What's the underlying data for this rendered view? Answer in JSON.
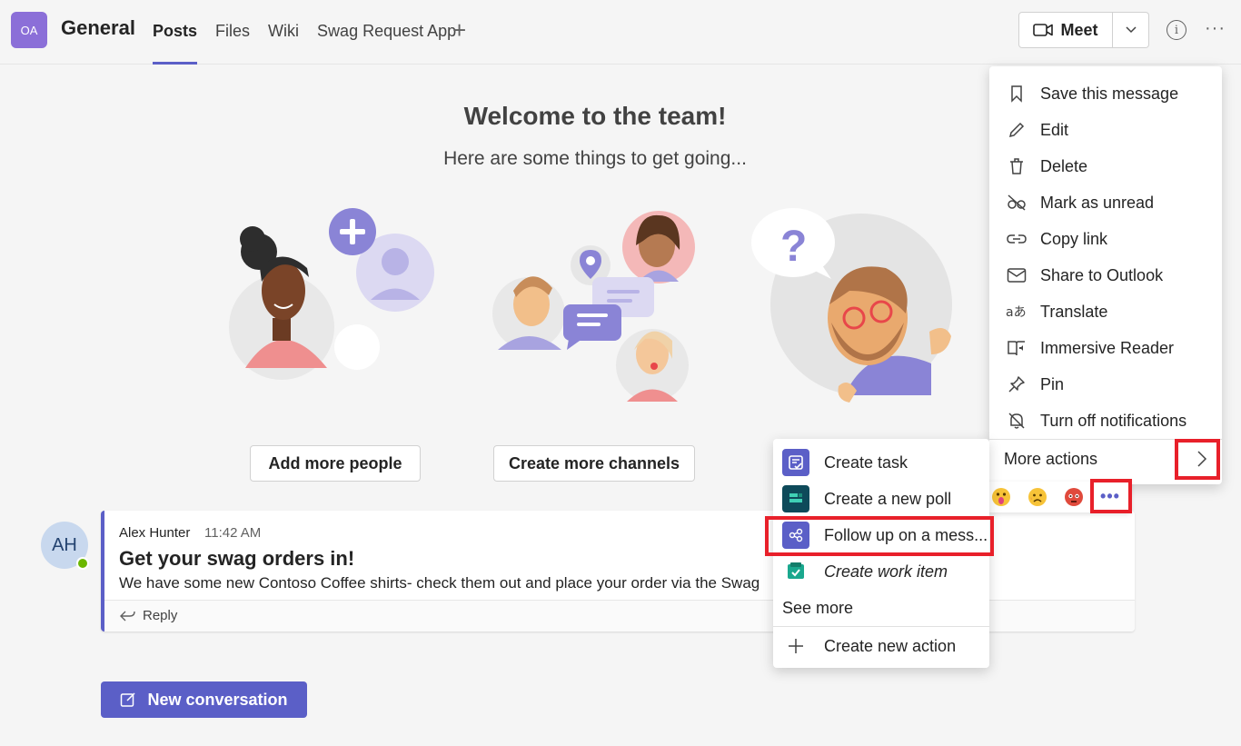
{
  "header": {
    "team_initials": "OA",
    "channel_name": "General",
    "tabs": [
      {
        "label": "Posts",
        "active": true
      },
      {
        "label": "Files",
        "active": false
      },
      {
        "label": "Wiki",
        "active": false
      },
      {
        "label": "Swag Request App",
        "active": false
      }
    ],
    "meet_label": "Meet"
  },
  "welcome": {
    "title": "Welcome to the team!",
    "subtitle": "Here are some things to get going...",
    "add_people_label": "Add more people",
    "create_channels_label": "Create more channels"
  },
  "post": {
    "avatar_initials": "AH",
    "author": "Alex Hunter",
    "time": "11:42 AM",
    "subject": "Get your swag orders in!",
    "body": "We have some new Contoso Coffee shirts- check them out and place your order via the Swag",
    "reply_label": "Reply"
  },
  "new_conversation_label": "New conversation",
  "context_menu": {
    "items": [
      {
        "label": "Save this message",
        "icon": "bookmark-icon"
      },
      {
        "label": "Edit",
        "icon": "pencil-icon"
      },
      {
        "label": "Delete",
        "icon": "trash-icon"
      },
      {
        "label": "Mark as unread",
        "icon": "eye-off-icon"
      },
      {
        "label": "Copy link",
        "icon": "link-icon"
      },
      {
        "label": "Share to Outlook",
        "icon": "mail-icon"
      },
      {
        "label": "Translate",
        "icon": "translate-icon"
      },
      {
        "label": "Immersive Reader",
        "icon": "immersive-reader-icon"
      },
      {
        "label": "Pin",
        "icon": "pin-icon"
      },
      {
        "label": "Turn off notifications",
        "icon": "bell-off-icon"
      }
    ],
    "more_actions_label": "More actions"
  },
  "more_actions_menu": {
    "items": [
      {
        "label": "Create task",
        "icon": "tasks-app-icon",
        "color": "#5b5fc7"
      },
      {
        "label": "Create a new poll",
        "icon": "polls-app-icon",
        "color": "#0e4a5a"
      },
      {
        "label": "Follow up on a mess...",
        "icon": "follow-up-app-icon",
        "color": "#5b5fc7"
      },
      {
        "label": "Create work item",
        "icon": "work-item-app-icon",
        "color": "#1aa88e"
      }
    ],
    "see_more_label": "See more",
    "create_new_action_label": "Create new action"
  },
  "colors": {
    "accent": "#5b5fc7",
    "highlight": "#e8202a"
  }
}
